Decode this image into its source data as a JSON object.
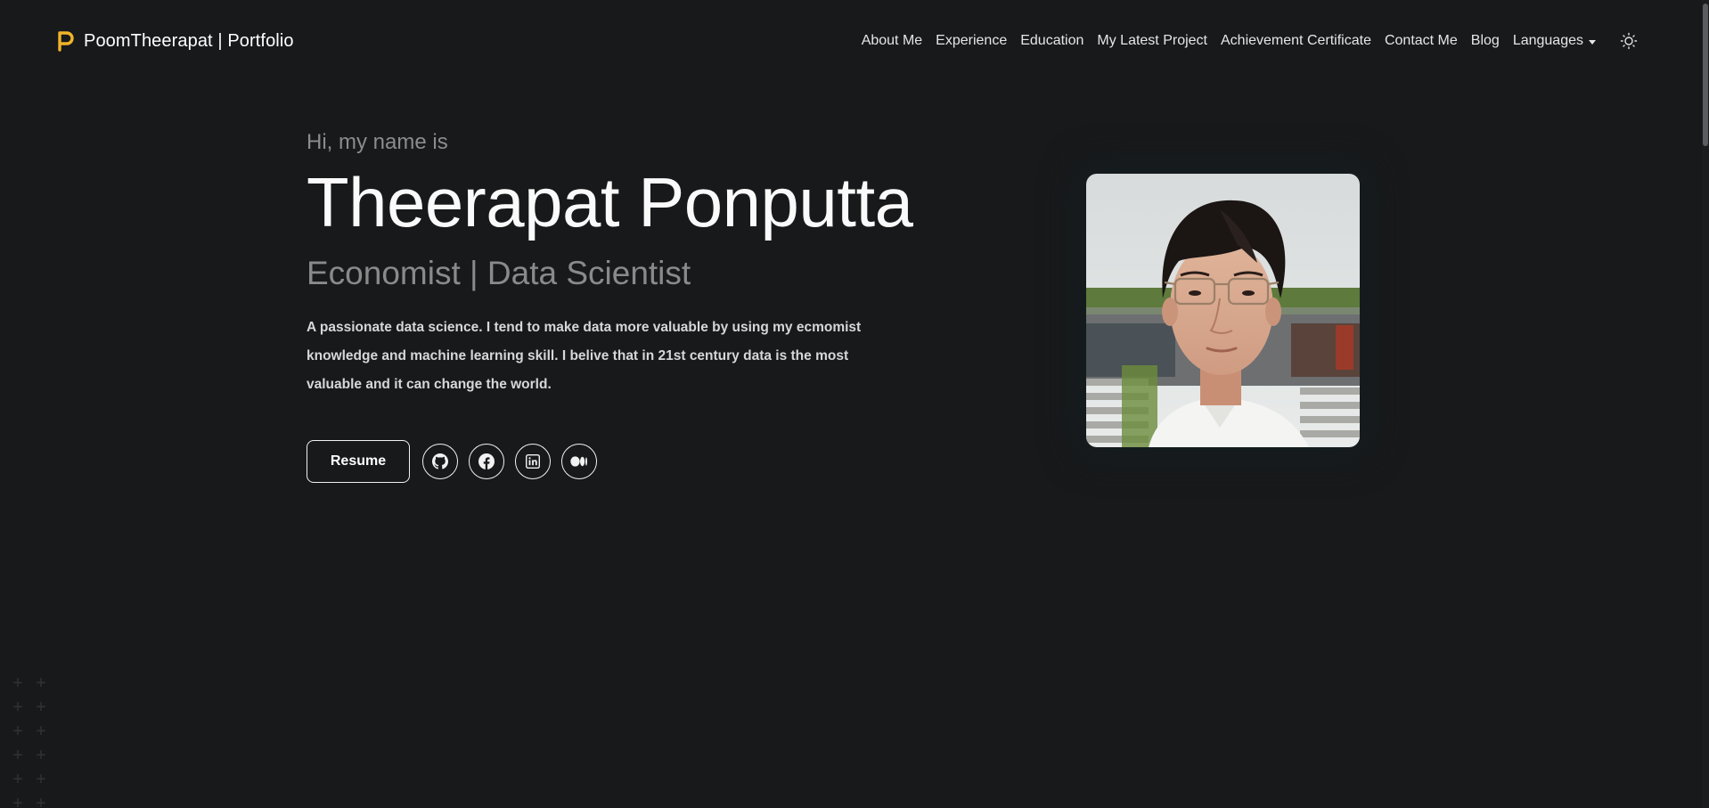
{
  "navbar": {
    "brand": "PoomTheerapat | Portfolio",
    "links": [
      "About Me",
      "Experience",
      "Education",
      "My Latest Project",
      "Achievement Certificate",
      "Contact Me",
      "Blog"
    ],
    "languages_label": "Languages",
    "theme_icon": "sun-icon"
  },
  "hero": {
    "greeting": "Hi, my name is",
    "name": "Theerapat Ponputta",
    "role": "Economist | Data Scientist",
    "bio": "A passionate data science. I tend to make data more valuable by using my ecmomist knowledge and machine learning skill. I belive that in 21st century data is the most valuable and it can change the world.",
    "resume_label": "Resume",
    "socials": [
      "github-icon",
      "facebook-icon",
      "linkedin-icon",
      "medium-icon"
    ]
  },
  "colors": {
    "background": "#18191b",
    "brand_accent": "#f0b429",
    "muted_text": "#8c8c8c"
  }
}
